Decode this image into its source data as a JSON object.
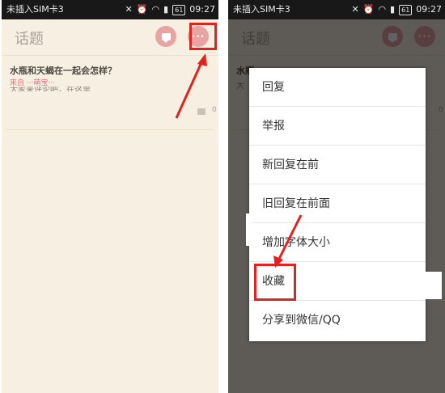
{
  "statusbar": {
    "carrier": "未插入SIM卡3",
    "battery": "61",
    "time": "09:27",
    "icons": [
      "mute-icon",
      "alarm-icon",
      "wifi-icon",
      "signal-icon",
      "battery-icon"
    ]
  },
  "left": {
    "title": "话题",
    "topic": {
      "title": "水瓶和天蝎在一起会怎样？",
      "source": "来自 ···萌宝···",
      "preview": "大家来评论吧，在这里",
      "comment_count": "0"
    }
  },
  "right": {
    "title": "话题",
    "topic": {
      "title": "水瓶",
      "preview": "大",
      "comment_count": "0"
    },
    "menu": [
      "回复",
      "举报",
      "新回复在前",
      "旧回复在前面",
      "增加字体大小",
      "收藏",
      "分享到微信/QQ"
    ]
  },
  "colors": {
    "accent": "#e8a3a3",
    "highlight": "#e0231e",
    "background": "#f6efe2"
  }
}
